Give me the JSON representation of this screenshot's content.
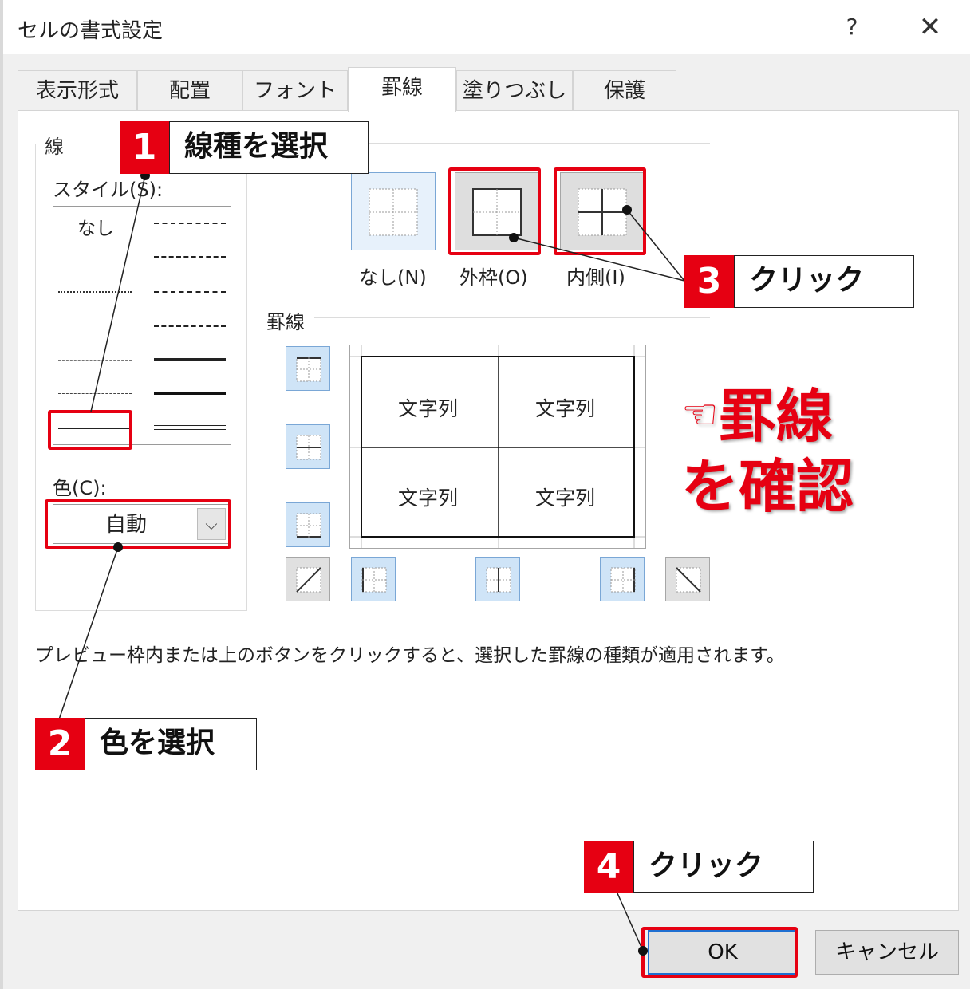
{
  "dialog": {
    "title": "セルの書式設定",
    "help": "?",
    "close": "✕"
  },
  "tabs": [
    {
      "label": "表示形式"
    },
    {
      "label": "配置"
    },
    {
      "label": "フォント"
    },
    {
      "label": "罫線",
      "active": true
    },
    {
      "label": "塗りつぶし"
    },
    {
      "label": "保護"
    }
  ],
  "line": {
    "group_label": "線",
    "style_label": "スタイル(S):",
    "style_none": "なし",
    "color_label": "色(C):",
    "color_value": "自動"
  },
  "presets": {
    "none_label": "なし(N)",
    "outline_label": "外枠(O)",
    "inside_label": "内側(I)"
  },
  "border": {
    "group_label": "罫線",
    "cells": [
      "文字列",
      "文字列",
      "文字列",
      "文字列"
    ]
  },
  "description": "プレビュー枠内または上のボタンをクリックすると、選択した罫線の種類が適用されます。",
  "buttons": {
    "ok": "OK",
    "cancel": "キャンセル"
  },
  "callouts": [
    {
      "num": "1",
      "text": "線種を選択"
    },
    {
      "num": "2",
      "text": "色を選択"
    },
    {
      "num": "3",
      "text": "クリック"
    },
    {
      "num": "4",
      "text": "クリック"
    }
  ],
  "annotation": {
    "hand": "☜",
    "line1": "罫線",
    "line2": "を確認"
  },
  "colors": {
    "accent_red": "#e60012",
    "selected_blue": "#cfe4f7"
  }
}
